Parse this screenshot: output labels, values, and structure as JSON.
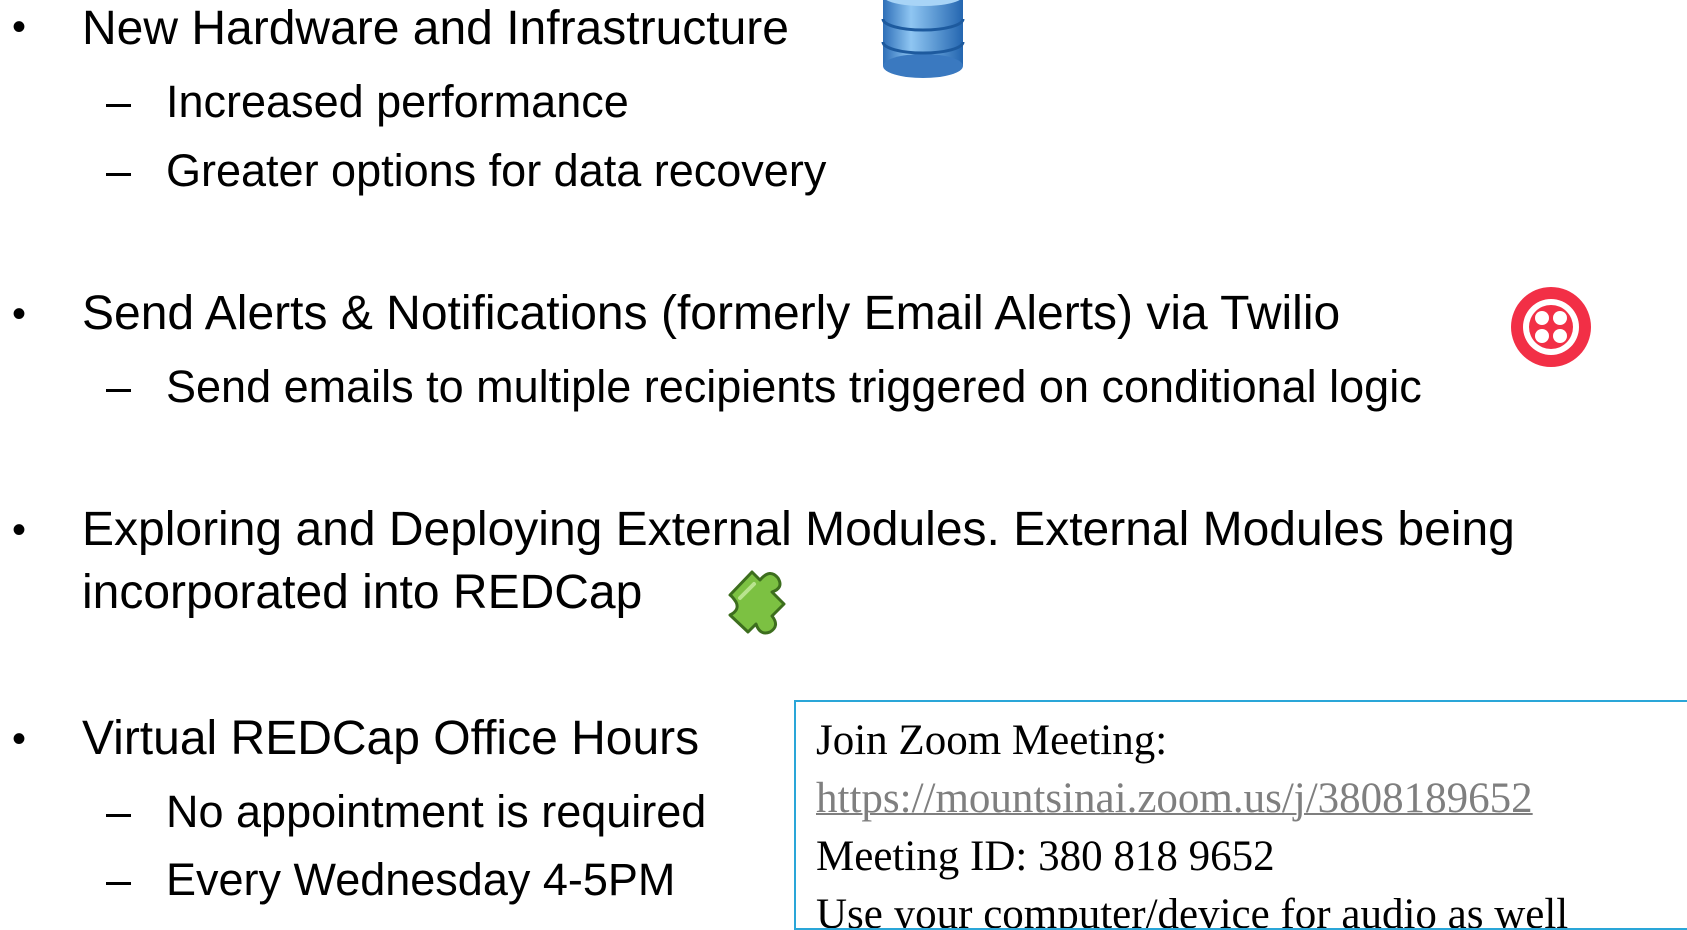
{
  "bullet_symbol": "•",
  "dash_symbol": "–",
  "sections": {
    "hardware": {
      "title": "New Hardware and Infrastructure",
      "icon": "database-icon",
      "sub": [
        "Increased performance",
        "Greater options for data recovery"
      ]
    },
    "alerts": {
      "title": "Send Alerts & Notifications (formerly Email Alerts) via Twilio",
      "icon": "twilio-logo-icon",
      "icon_color": "#f22f46",
      "sub": [
        "Send emails to multiple recipients triggered on conditional logic"
      ]
    },
    "modules": {
      "title_line1": "Exploring and Deploying External Modules. External Modules being",
      "title_line2": "incorporated into REDCap",
      "icon": "puzzle-piece-icon",
      "icon_color": "#7cc142"
    },
    "office_hours": {
      "title": "Virtual REDCap Office Hours",
      "sub": [
        "No appointment is required",
        "Every Wednesday 4-5PM"
      ]
    }
  },
  "zoom": {
    "heading": "Join Zoom Meeting:",
    "link": "https://mountsinai.zoom.us/j/3808189652",
    "meeting_id": "Meeting ID: 380 818 9652",
    "partial_line": "Use your computer/device for audio as well"
  },
  "colors": {
    "zoom_border": "#2aa6d8",
    "link_gray": "#7f7f7f"
  }
}
